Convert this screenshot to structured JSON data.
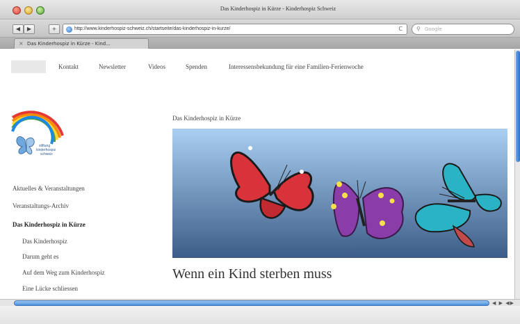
{
  "window": {
    "title": "Das Kinderhospiz in Kürze - Kinderhospiz Schweiz"
  },
  "toolbar": {
    "back_label": "◀",
    "forward_label": "▶",
    "add_label": "+",
    "url": "http://www.kinderhospiz-schweiz.ch/startseite/das-kinderhospiz-in-kurze/",
    "reload_label": "C",
    "search_placeholder": "Google"
  },
  "tabs": [
    {
      "label": "Das Kinderhospiz in Kürze - Kind..."
    }
  ],
  "topnav": {
    "items": [
      {
        "label": "Kontakt"
      },
      {
        "label": "Newsletter"
      },
      {
        "label": "Videos"
      },
      {
        "label": "Spenden"
      },
      {
        "label": "Interessensbekundung für eine Familien-Ferienwoche"
      }
    ]
  },
  "logo": {
    "text_lines": [
      "stiftung",
      "kinderhospiz",
      "schweiz"
    ]
  },
  "sidebar": {
    "items": [
      {
        "label": "Aktuelles & Veranstaltungen"
      },
      {
        "label": "Veranstaltungs-Archiv"
      },
      {
        "label": "Das Kinderhospiz in Kürze"
      },
      {
        "label": "Das Kinderhospiz"
      },
      {
        "label": "Darum geht es"
      },
      {
        "label": "Auf dem Weg zum Kinderhospiz"
      },
      {
        "label": "Eine Lücke schliessen"
      }
    ]
  },
  "main": {
    "section_title": "Das Kinderhospiz in Kürze",
    "headline": "Wenn ein Kind sterben muss"
  },
  "colors": {
    "hero_sky_top": "#a9cff2",
    "hero_sky_bottom": "#3d5d88",
    "butterfly_red": "#d8323a",
    "butterfly_purple": "#8a3da8",
    "butterfly_teal": "#2ab3c4"
  }
}
